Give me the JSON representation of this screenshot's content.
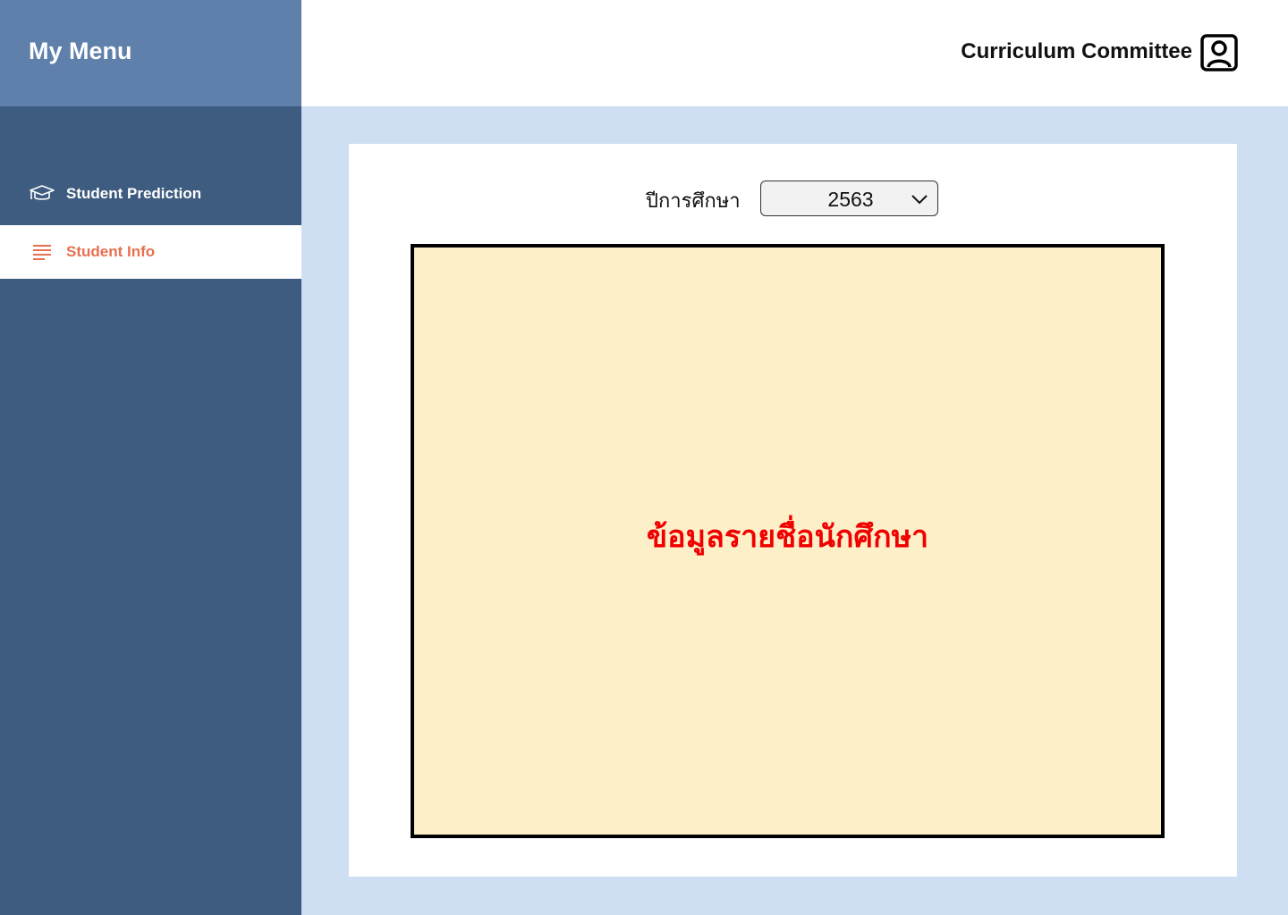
{
  "sidebar": {
    "title": "My Menu",
    "items": [
      {
        "label": "Student Prediction",
        "icon": "graduation-cap-icon",
        "active": false
      },
      {
        "label": "Student Info",
        "icon": "list-icon",
        "active": true
      }
    ]
  },
  "header": {
    "user_name": "Curriculum Committee",
    "user_icon": "user-profile-icon"
  },
  "main": {
    "year_label": "ปีการศึกษา",
    "year_select": {
      "value": "2563"
    },
    "student_list_placeholder": "ข้อมูลรายชื่อนักศึกษา"
  },
  "colors": {
    "sidebar_bg": "#3e5c80",
    "sidebar_header_bg": "#5e80ab",
    "content_bg": "#cfdff3",
    "accent": "#e8704f",
    "placeholder_fill": "#fdefc8",
    "placeholder_text": "#f00000"
  }
}
